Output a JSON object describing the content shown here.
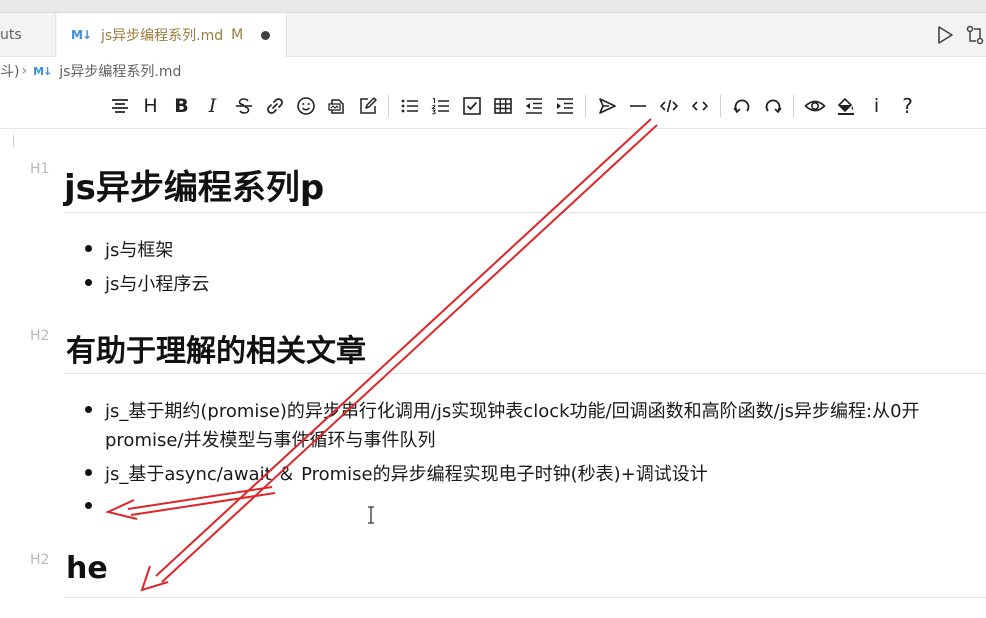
{
  "tabs": {
    "prev_label": "uts",
    "active": {
      "icon": "markdown-icon",
      "icon_text": "M↓",
      "title": "js异步编程系列.md",
      "status": "M"
    }
  },
  "breadcrumb": {
    "prefix": "斗)",
    "separator": "›",
    "icon_text": "M↓",
    "file": "js异步编程系列.md"
  },
  "toolbar": {
    "heading_label": "H",
    "bold_label": "B",
    "italic_label": "I",
    "info_label": "i",
    "help_label": "?"
  },
  "document": {
    "h1_label": "H1",
    "h1": "js异步编程系列p",
    "list1": [
      "js与框架",
      "js与小程序云"
    ],
    "h2a_label": "H2",
    "h2a": "有助于理解的相关文章",
    "list2": [
      "js_基于期约(promise)的异步串行化调用/js实现钟表clock功能/回调函数和高阶函数/js异步编程:从0开",
      "promise/并发模型与事件循环与事件队列",
      "js_基于async/await ＆ Promise的异步编程实现电子时钟(秒表)+调试设计",
      ""
    ],
    "h2b_label": "H2",
    "h2b": "he"
  },
  "colors": {
    "annotation": "#e0252a",
    "modified": "#9a7d3a",
    "markdown_icon": "#3b8ee0"
  }
}
